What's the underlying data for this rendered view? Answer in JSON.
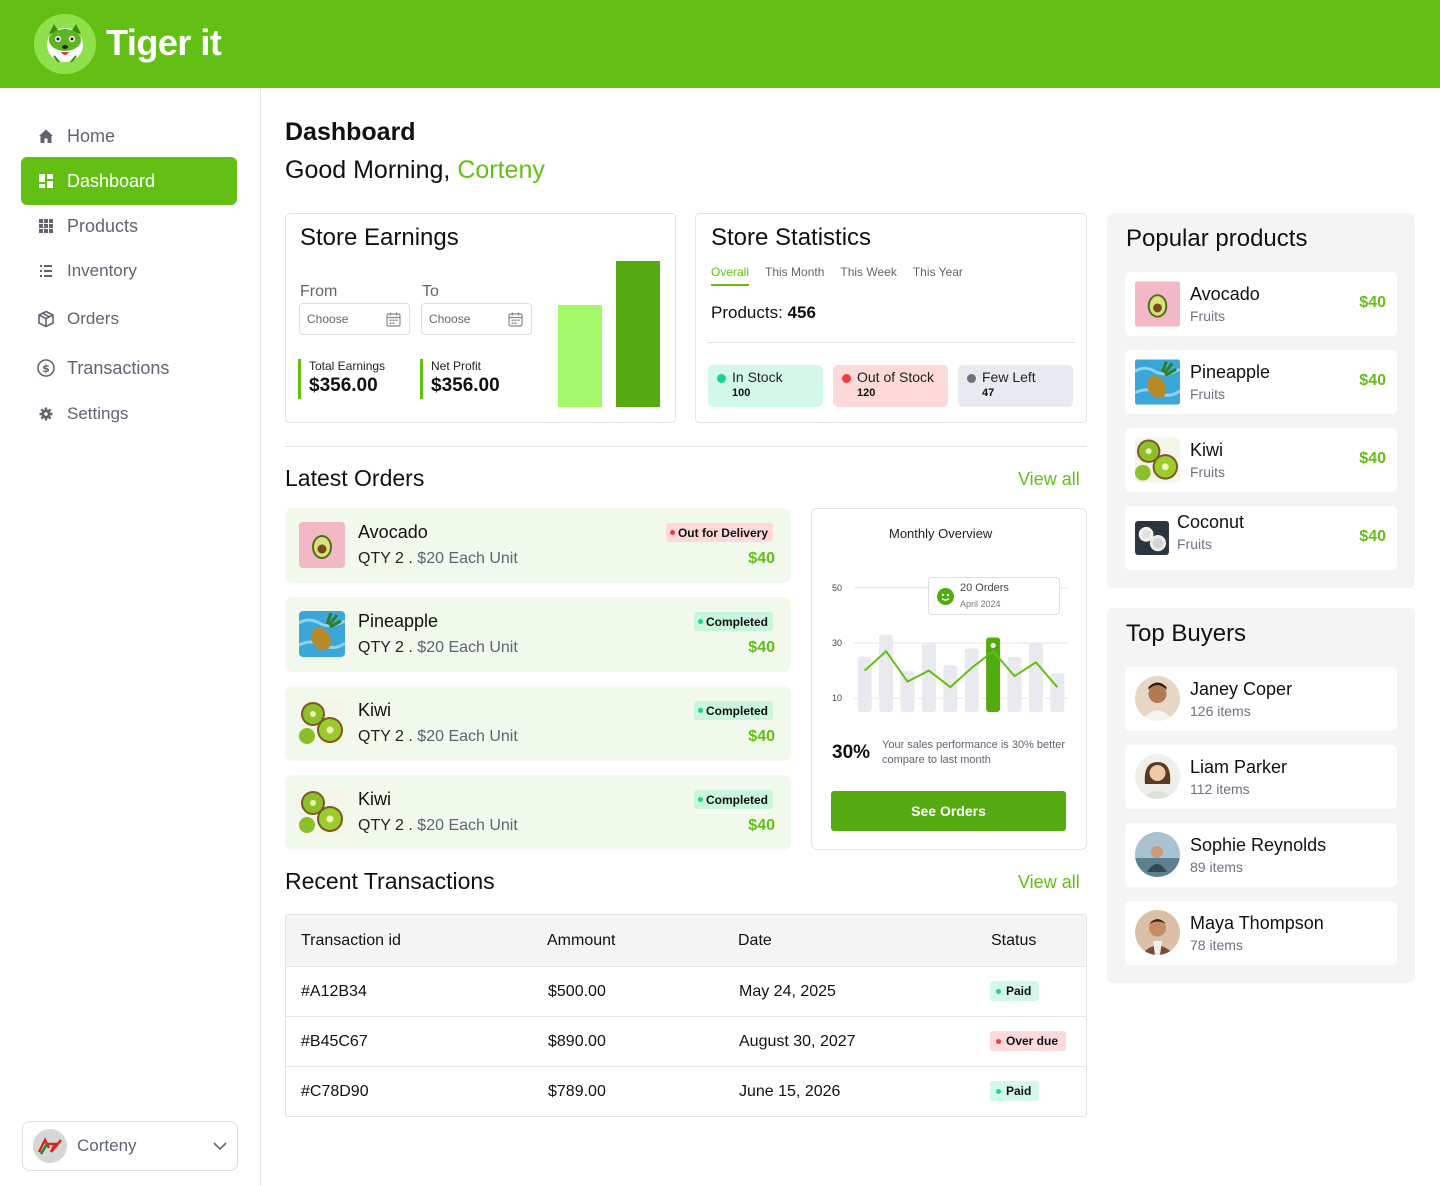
{
  "brand": {
    "name": "Tiger it",
    "color": "#64bf14"
  },
  "sidebar": {
    "items": [
      {
        "label": "Home",
        "icon": "home-icon"
      },
      {
        "label": "Dashboard",
        "icon": "dashboard-icon",
        "active": true
      },
      {
        "label": "Products",
        "icon": "grid-icon"
      },
      {
        "label": "Inventory",
        "icon": "list-icon"
      },
      {
        "label": "Orders",
        "icon": "box-icon"
      },
      {
        "label": "Transactions",
        "icon": "dollar-icon"
      },
      {
        "label": "Settings",
        "icon": "gear-icon"
      }
    ],
    "user": {
      "name": "Corteny"
    }
  },
  "header": {
    "title": "Dashboard",
    "greeting": "Good Morning,",
    "user_name": "Corteny"
  },
  "store_earnings": {
    "title": "Store Earnings",
    "from_label": "From",
    "to_label": "To",
    "from_placeholder": "Choose",
    "to_placeholder": "Choose",
    "total_label": "Total Earnings",
    "total_value": "$356.00",
    "profit_label": "Net Profit",
    "profit_value": "$356.00",
    "bars": [
      {
        "value": 0.7,
        "color": "#a3f86a"
      },
      {
        "value": 1.0,
        "color": "#55a911"
      }
    ]
  },
  "store_statistics": {
    "title": "Store Statistics",
    "tabs": [
      "Overall",
      "This Month",
      "This Week",
      "This Year"
    ],
    "products_label": "Products:",
    "products_value": "456",
    "stock": [
      {
        "label": "In Stock",
        "value": "100",
        "bg": "#d3f8ea",
        "dot": "#1bd39a"
      },
      {
        "label": "Out of Stock",
        "value": "120",
        "bg": "#fdd9d9",
        "dot": "#f03e3e"
      },
      {
        "label": "Few Left",
        "value": "47",
        "bg": "#e8eaef",
        "dot": "#6d7280"
      }
    ]
  },
  "latest_orders": {
    "title": "Latest Orders",
    "view_all": "View all",
    "items": [
      {
        "name": "Avocado",
        "qty": "QTY 2 .",
        "unit": "$20 Each Unit",
        "status": "Out for Delivery",
        "status_bg": "#fdd9d9",
        "status_dot": "#f03e3e",
        "price": "$40",
        "image": "avocado"
      },
      {
        "name": "Pineapple",
        "qty": "QTY 2 .",
        "unit": "$20 Each Unit",
        "status": "Completed",
        "status_bg": "#c9f5dd",
        "status_dot": "#1bd39a",
        "price": "$40",
        "image": "pineapple"
      },
      {
        "name": "Kiwi",
        "qty": "QTY 2 .",
        "unit": "$20 Each Unit",
        "status": "Completed",
        "status_bg": "#c9f5dd",
        "status_dot": "#1bd39a",
        "price": "$40",
        "image": "kiwi"
      },
      {
        "name": "Kiwi",
        "qty": "QTY 2 .",
        "unit": "$20 Each Unit",
        "status": "Completed",
        "status_bg": "#c9f5dd",
        "status_dot": "#1bd39a",
        "price": "$40",
        "image": "kiwi"
      }
    ]
  },
  "monthly_overview": {
    "title": "Monthly Overview",
    "tooltip_orders": "20 Orders",
    "tooltip_date": "April 2024",
    "percent": "30%",
    "description": "Your sales performance is 30% better compare to last month",
    "button": "See Orders"
  },
  "chart_data": {
    "type": "bar",
    "y_ticks": [
      "50",
      "30",
      "10"
    ],
    "ylim": [
      5,
      55
    ],
    "bars": [
      25,
      33,
      20,
      30,
      22,
      28,
      32,
      25,
      30,
      19
    ],
    "line": [
      20,
      27,
      16,
      20,
      14,
      21,
      27,
      18,
      23,
      14
    ],
    "highlight_index": 6
  },
  "recent_transactions": {
    "title": "Recent Transactions",
    "view_all": "View all",
    "columns": [
      "Transaction id",
      "Ammount",
      "Date",
      "Status"
    ],
    "rows": [
      {
        "id": "#A12B34",
        "amount": "$500.00",
        "date": "May 24, 2025",
        "status": "Paid",
        "status_bg": "#d3f8ea",
        "status_dot": "#1bd39a"
      },
      {
        "id": "#B45C67",
        "amount": "$890.00",
        "date": "August 30, 2027",
        "status": "Over due",
        "status_bg": "#fdd9d9",
        "status_dot": "#f03e3e"
      },
      {
        "id": "#C78D90",
        "amount": "$789.00",
        "date": "June 15, 2026",
        "status": "Paid",
        "status_bg": "#d3f8ea",
        "status_dot": "#1bd39a"
      }
    ]
  },
  "popular_products": {
    "title": "Popular products",
    "items": [
      {
        "name": "Avocado",
        "category": "Fruits",
        "price": "$40",
        "image": "avocado"
      },
      {
        "name": "Pineapple",
        "category": "Fruits",
        "price": "$40",
        "image": "pineapple"
      },
      {
        "name": "Kiwi",
        "category": "Fruits",
        "price": "$40",
        "image": "kiwi"
      },
      {
        "name": "Coconut",
        "category": "Fruits",
        "price": "$40",
        "image": "coconut"
      }
    ]
  },
  "top_buyers": {
    "title": "Top Buyers",
    "items": [
      {
        "name": "Janey Coper",
        "items": "126 items"
      },
      {
        "name": "Liam Parker",
        "items": "112 items"
      },
      {
        "name": "Sophie Reynolds",
        "items": "89 items"
      },
      {
        "name": "Maya Thompson",
        "items": "78 items"
      }
    ]
  }
}
